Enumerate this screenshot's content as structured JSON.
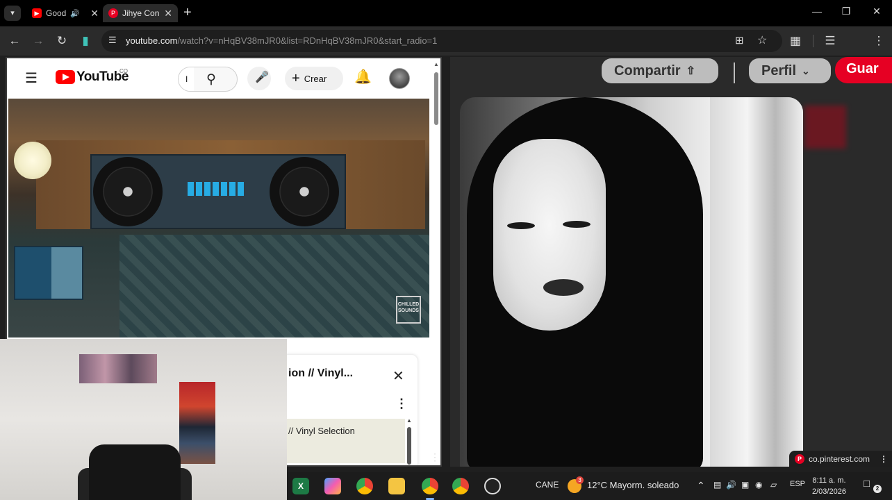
{
  "browser": {
    "tabs": [
      {
        "title": "Good",
        "favicon": "youtube",
        "audio": true
      },
      {
        "title": "Jihye Con",
        "favicon": "pinterest",
        "audio": false
      }
    ],
    "new_tab_glyph": "+",
    "url_host": "youtube.com",
    "url_rest": "/watch?v=nHqBV38mJR0&list=RDnHqBV38mJR0&start_radio=1"
  },
  "youtube": {
    "brand": "YouTube",
    "country": "CO",
    "search_value": "I",
    "create_label": "Crear",
    "mini_title": "ion // Vinyl...",
    "mini_item": "// Vinyl Selection",
    "video_tag": "CHILLED SOUNDS"
  },
  "pinterest": {
    "share_label": "Compartir",
    "profile_label": "Perfil",
    "save_label": "Guar",
    "status_host": "co.pinterest.com"
  },
  "taskbar": {
    "tray_text": "CANE",
    "weather_badge": "3",
    "weather": "12°C  Mayorm. soleado",
    "lang": "ESP",
    "time": "8:11 a. m.",
    "date": "2/03/2026",
    "notif_count": "2"
  },
  "colors": {
    "youtube_red": "#ff0000",
    "pinterest_red": "#e60023",
    "accent_blue": "#7fb2ff"
  }
}
